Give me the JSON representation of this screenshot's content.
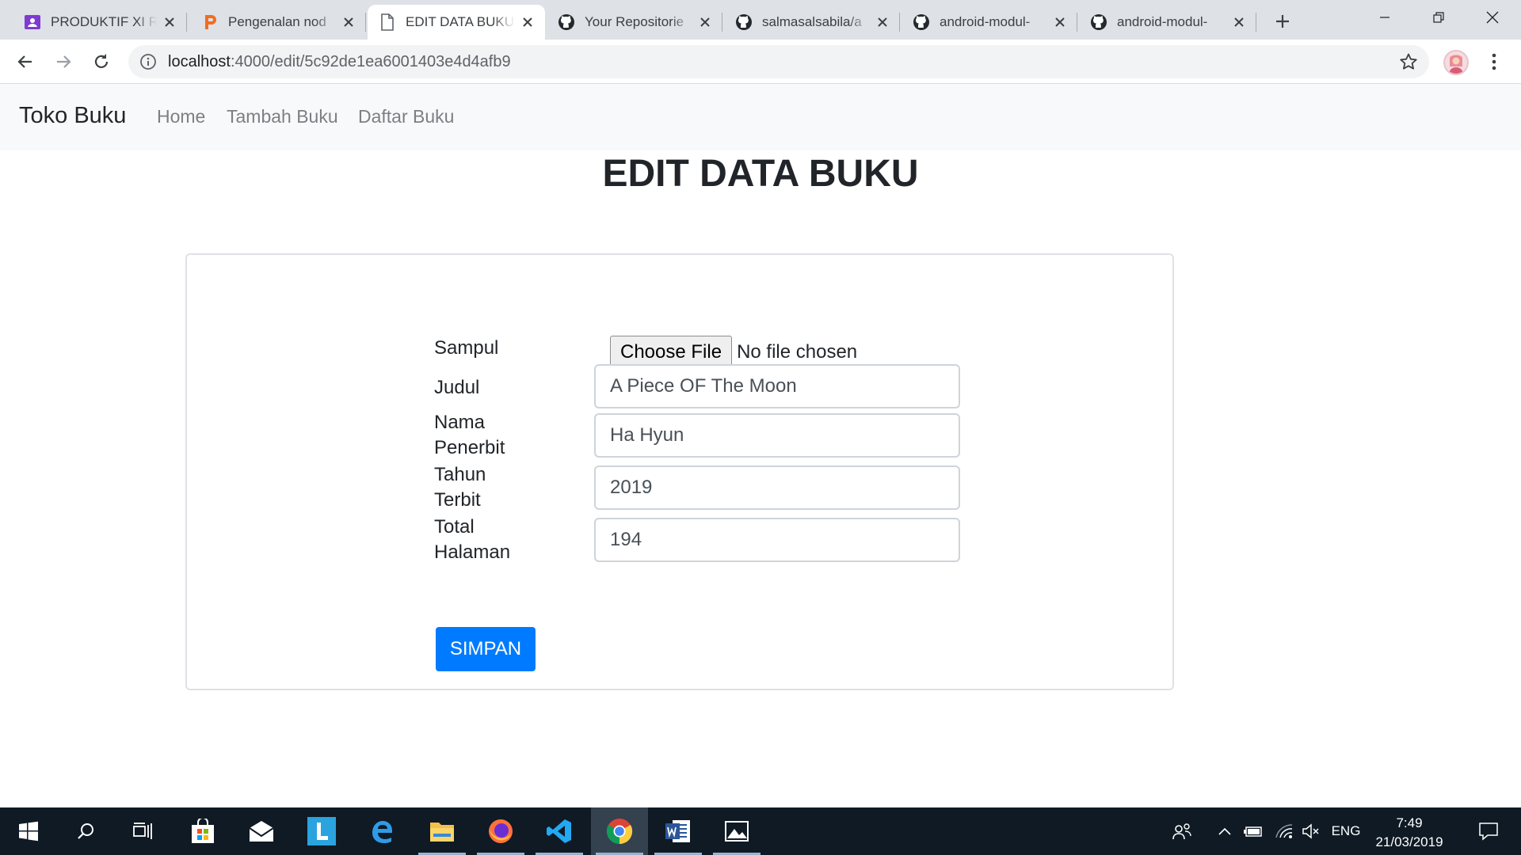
{
  "browser": {
    "tabs": [
      {
        "title": "PRODUKTIF XI R",
        "icon": "classroom-icon",
        "active": false
      },
      {
        "title": "Pengenalan nod",
        "icon": "p-logo-icon",
        "active": false
      },
      {
        "title": "EDIT DATA BUKU",
        "icon": "document-icon",
        "active": true
      },
      {
        "title": "Your Repositorie",
        "icon": "github-icon",
        "active": false
      },
      {
        "title": "salmasalsabila/a",
        "icon": "github-icon",
        "active": false
      },
      {
        "title": "android-modul-",
        "icon": "github-icon",
        "active": false
      },
      {
        "title": "android-modul-",
        "icon": "github-icon",
        "active": false
      }
    ],
    "url_host": "localhost",
    "url_path": ":4000/edit/5c92de1ea6001403e4d4afb9"
  },
  "navbar": {
    "brand": "Toko Buku",
    "links": [
      "Home",
      "Tambah Buku",
      "Daftar Buku"
    ]
  },
  "page": {
    "heading": "EDIT DATA BUKU"
  },
  "form": {
    "sampul_label": "Sampul",
    "file_button": "Choose File",
    "file_status": "No file chosen",
    "judul_label": "Judul",
    "judul_value": "A Piece OF The Moon",
    "penerbit_label_1": "Nama",
    "penerbit_label_2": "Penerbit",
    "penerbit_value": "Ha Hyun",
    "tahun_label_1": "Tahun",
    "tahun_label_2": "Terbit",
    "tahun_value": "2019",
    "halaman_label_1": "Total",
    "halaman_label_2": "Halaman",
    "halaman_value": "194",
    "submit_label": "SIMPAN"
  },
  "taskbar": {
    "apps": [
      "start-icon",
      "search-icon",
      "task-view-icon",
      "store-icon",
      "mail-icon",
      "l-app-icon",
      "edge-icon",
      "file-explorer-icon",
      "firefox-icon",
      "vscode-icon",
      "chrome-icon",
      "word-icon",
      "photos-icon"
    ],
    "language": "ENG",
    "time": "7:49",
    "date": "21/03/2019"
  },
  "colors": {
    "primary_button": "#007bff",
    "navbar_bg": "#f8f9fa",
    "taskbar_bg": "#0f1a24"
  }
}
